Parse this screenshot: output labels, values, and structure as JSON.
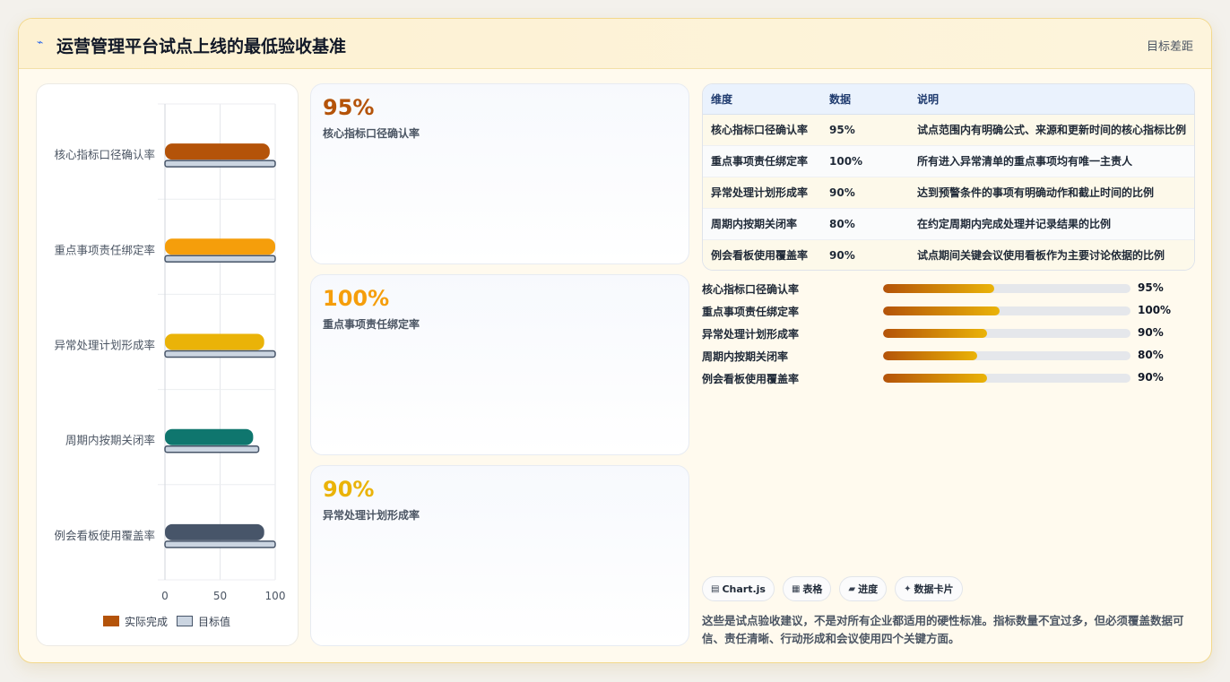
{
  "header": {
    "title": "运营管理平台试点上线的最低验收基准",
    "right": "目标差距"
  },
  "colors": {
    "series1": "#b45309",
    "series2": "#f59e0b",
    "series3": "#eab308",
    "series4": "#0f766e",
    "series5": "#475569",
    "target": "#cbd5e1"
  },
  "chart_data": {
    "type": "bar",
    "orientation": "horizontal",
    "categories": [
      "核心指标口径确认率",
      "重点事项责任绑定率",
      "异常处理计划形成率",
      "周期内按期关闭率",
      "例会看板使用覆盖率"
    ],
    "series": [
      {
        "name": "实际完成",
        "values": [
          95,
          100,
          90,
          80,
          90
        ]
      },
      {
        "name": "目标值",
        "values": [
          100,
          100,
          100,
          85,
          100
        ]
      }
    ],
    "xlim": [
      0,
      100
    ],
    "xticks": [
      "0",
      "50",
      "100"
    ],
    "grid": true,
    "legend": "bottom"
  },
  "metrics": [
    {
      "value": "95%",
      "label": "核心指标口径确认率",
      "color": "#b45309"
    },
    {
      "value": "100%",
      "label": "重点事项责任绑定率",
      "color": "#f59e0b"
    },
    {
      "value": "90%",
      "label": "异常处理计划形成率",
      "color": "#eab308"
    }
  ],
  "table": {
    "headers": [
      "维度",
      "数据",
      "说明"
    ],
    "rows": [
      [
        "核心指标口径确认率",
        "95%",
        "试点范围内有明确公式、来源和更新时间的核心指标比例"
      ],
      [
        "重点事项责任绑定率",
        "100%",
        "所有进入异常清单的重点事项均有唯一主责人"
      ],
      [
        "异常处理计划形成率",
        "90%",
        "达到预警条件的事项有明确动作和截止时间的比例"
      ],
      [
        "周期内按期关闭率",
        "80%",
        "在约定周期内完成处理并记录结果的比例"
      ],
      [
        "例会看板使用覆盖率",
        "90%",
        "试点期间关键会议使用看板作为主要讨论依据的比例"
      ]
    ]
  },
  "progress": [
    {
      "label": "核心指标口径确认率",
      "value": "95%",
      "fill": 0.45
    },
    {
      "label": "重点事项责任绑定率",
      "value": "100%",
      "fill": 0.47
    },
    {
      "label": "异常处理计划形成率",
      "value": "90%",
      "fill": 0.42
    },
    {
      "label": "周期内按期关闭率",
      "value": "80%",
      "fill": 0.38
    },
    {
      "label": "例会看板使用覆盖率",
      "value": "90%",
      "fill": 0.42
    }
  ],
  "chips": [
    {
      "icon": "chart-icon",
      "label": "Chart.js"
    },
    {
      "icon": "table-icon",
      "label": "表格"
    },
    {
      "icon": "progress-icon",
      "label": "进度"
    },
    {
      "icon": "card-icon",
      "label": "数据卡片"
    }
  ],
  "footnote": "这些是试点验收建议，不是对所有企业都适用的硬性标准。指标数量不宜过多，但必须覆盖数据可信、责任清晰、行动形成和会议使用四个关键方面。"
}
